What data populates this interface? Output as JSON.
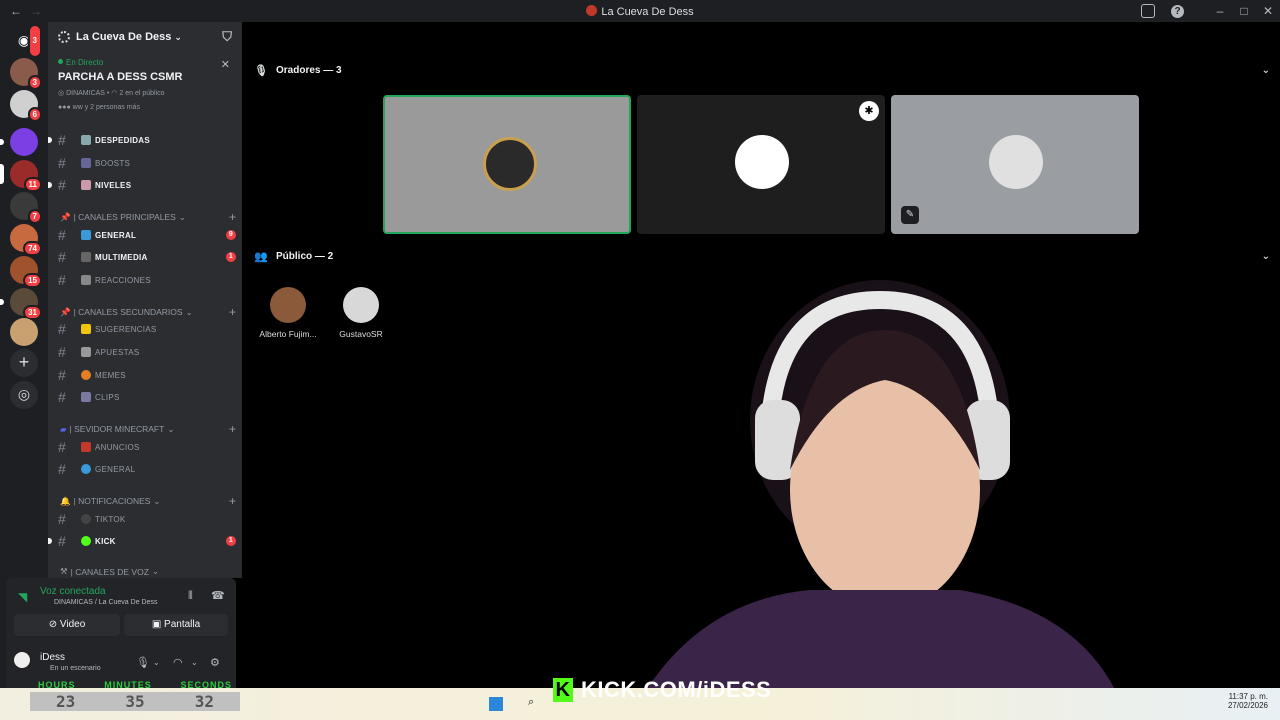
{
  "window": {
    "title": "La Cueva De Dess"
  },
  "server": {
    "name": "La Cueva De Dess"
  },
  "guild_badges": [
    "3",
    "3",
    "6",
    "11",
    "7",
    "74",
    "15",
    "31"
  ],
  "live_event": {
    "status": "En Directo",
    "title": "PARCHA A DESS CSMR",
    "category": "DINAMICAS",
    "audience": "2 en el público",
    "others": "ww y 2 personas más"
  },
  "channels": [
    {
      "name": "DESPEDIDAS",
      "bold": true,
      "badge": ""
    },
    {
      "name": "BOOSTS",
      "bold": false,
      "badge": ""
    },
    {
      "name": "NIVELES",
      "bold": true,
      "badge": ""
    },
    {
      "name": "GENERAL",
      "bold": true,
      "badge": "9"
    },
    {
      "name": "MULTIMEDIA",
      "bold": true,
      "badge": "1"
    },
    {
      "name": "REACCIONES",
      "bold": false,
      "badge": ""
    },
    {
      "name": "SUGERENCIAS",
      "bold": false,
      "badge": ""
    },
    {
      "name": "APUESTAS",
      "bold": false,
      "badge": ""
    },
    {
      "name": "MEMES",
      "bold": false,
      "badge": ""
    },
    {
      "name": "CLIPS",
      "bold": false,
      "badge": ""
    },
    {
      "name": "ANUNCIOS",
      "bold": false,
      "badge": ""
    },
    {
      "name": "GENERAL",
      "bold": false,
      "badge": ""
    },
    {
      "name": "TIKTOK",
      "bold": false,
      "badge": ""
    },
    {
      "name": "KICK",
      "bold": true,
      "badge": "1"
    }
  ],
  "categories": [
    "| CANALES PRINCIPALES",
    "| CANALES SECUNDARIOS",
    "| SEVIDOR MINECRAFT",
    "| NOTIFICACIONES",
    "| CANALES DE VOZ"
  ],
  "voice_panel": {
    "status": "Voz conectada",
    "location": "DINAMICAS / La Cueva De Dess",
    "video_label": "Video",
    "screen_label": "Pantalla",
    "username": "iDess",
    "user_status": "En un escenario"
  },
  "stage": {
    "speakers_header": "Oradores — 3",
    "audience_header": "Público — 2",
    "audience": [
      {
        "name": "Alberto Fujim..."
      },
      {
        "name": "GustavoSR"
      }
    ]
  },
  "overlay": {
    "timer_labels": [
      "HOURS",
      "MINUTES",
      "SECONDS"
    ],
    "timer_values": [
      "23",
      "35",
      "32"
    ],
    "kick_text": "KICK.COM/iDESS",
    "clock_time": "11:37 p. m.",
    "clock_date": "27/02/2026"
  }
}
